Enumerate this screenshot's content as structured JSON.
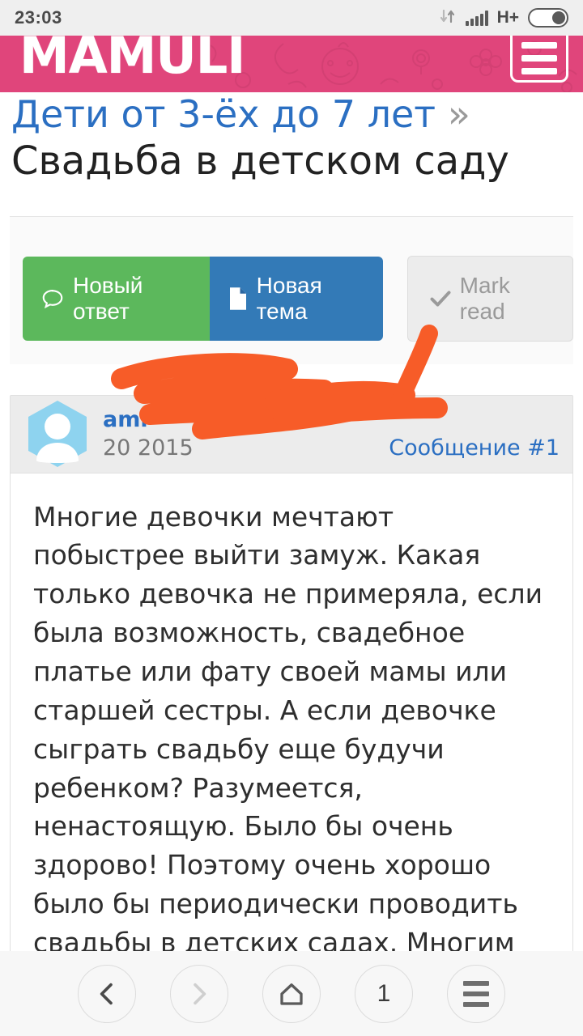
{
  "status_bar": {
    "time": "23:03",
    "network_type": "H+",
    "icons": [
      "data-transfer-icon",
      "signal-icon",
      "battery-icon"
    ]
  },
  "site_header": {
    "logo_text": "MAMULI",
    "background_color": "#e0457b",
    "menu_icon": "hamburger-menu-icon"
  },
  "breadcrumb": {
    "label": "Дети от 3-ёх до 7 лет",
    "separator": "»",
    "link_color": "#2b6fc2"
  },
  "page": {
    "title": "Свадьба в детском саду"
  },
  "toolbar": {
    "reply_label": "Новый ответ",
    "new_topic_label": "Новая тема",
    "mark_read_label": "Mark read",
    "reply_color": "#5cb85c",
    "new_topic_color": "#337ab7",
    "mark_read_color": "#ececec"
  },
  "post": {
    "author": "ami",
    "date": "20               2015",
    "post_number": "Сообщение #1",
    "body": "Многие девочки мечтают побыстрее выйти замуж. Какая только девочка не примеряла, если была возможность, свадебное платье или фату своей мамы или старшей сестры. А если девочке сыграть свадьбу еще будучи ребенком? Разумеется, ненастоящую. Было бы очень здорово! Поэтому очень хорошо было бы периодически проводить свадьбы в детских садах. Многим детям это будет очень интересно, а может быть, подобное мероприятие станет самым счастливым в",
    "avatar_icon": "user-avatar-icon",
    "redaction_color": "#f75c28"
  },
  "nav_bar": {
    "back_label": "back-icon",
    "forward_label": "forward-icon",
    "home_label": "home-icon",
    "tab_count": "1",
    "menu_label": "menu-icon"
  }
}
